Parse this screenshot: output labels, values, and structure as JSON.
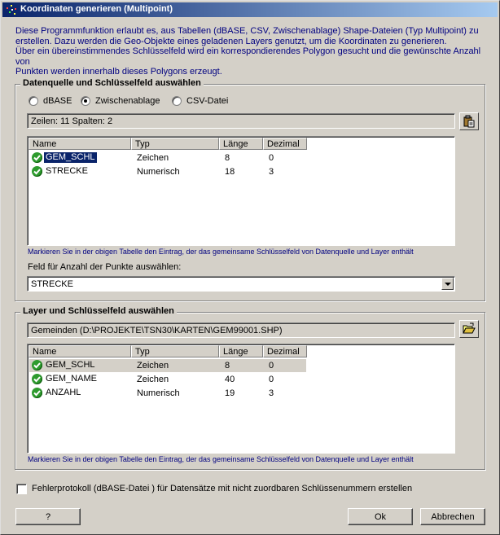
{
  "window": {
    "title": "Koordinaten generieren (Multipoint)"
  },
  "intro": {
    "line1": "Diese Programmfunktion erlaubt es, aus Tabellen (dBASE, CSV, Zwischenablage) Shape-Dateien (Typ Multipoint) zu",
    "line2": "erstellen. Dazu werden die Geo-Objekte eines geladenen Layers genutzt, um die Koordinaten zu generieren.",
    "line3": "Über ein übereinstimmendes Schlüsselfeld wird ein korrespondierendes Polygon gesucht und die gewünschte Anzahl von",
    "line4": "Punkten werden innerhalb dieses Polygons erzeugt."
  },
  "source": {
    "group_title": "Datenquelle und Schlüsselfeld auswählen",
    "radio_dbase": "dBASE",
    "radio_clipboard": "Zwischenablage",
    "radio_csv": "CSV-Datei",
    "selected_radio": "Zwischenablage",
    "info": "Zeilen: 11   Spalten: 2",
    "columns": {
      "name": "Name",
      "type": "Typ",
      "length": "Länge",
      "decimal": "Dezimal"
    },
    "rows": [
      {
        "name": "GEM_SCHL",
        "type": "Zeichen",
        "length": "8",
        "decimal": "0"
      },
      {
        "name": "STRECKE",
        "type": "Numerisch",
        "length": "18",
        "decimal": "3"
      }
    ],
    "hint": "Markieren Sie in der obigen Tabelle den Eintrag, der das gemeinsame Schlüsselfeld von Datenquelle und Layer enthält",
    "count_label": "Feld für Anzahl der Punkte auswählen:",
    "count_value": "STRECKE"
  },
  "layer": {
    "group_title": "Layer und Schlüsselfeld auswählen",
    "info": "Gemeinden (D:\\PROJEKTE\\TSN30\\KARTEN\\GEM99001.SHP)",
    "columns": {
      "name": "Name",
      "type": "Typ",
      "length": "Länge",
      "decimal": "Dezimal"
    },
    "rows": [
      {
        "name": "GEM_SCHL",
        "type": "Zeichen",
        "length": "8",
        "decimal": "0"
      },
      {
        "name": "GEM_NAME",
        "type": "Zeichen",
        "length": "40",
        "decimal": "0"
      },
      {
        "name": "ANZAHL",
        "type": "Numerisch",
        "length": "19",
        "decimal": "3"
      }
    ],
    "hint": "Markieren Sie in der obigen Tabelle den Eintrag, der das gemeinsame Schlüsselfeld von Datenquelle und Layer enthält"
  },
  "error_log": {
    "label": "Fehlerprotokoll (dBASE-Datei ) für Datensätze mit nicht zuordbaren Schlüssenummern erstellen",
    "checked": false
  },
  "buttons": {
    "help": "?",
    "ok": "Ok",
    "cancel": "Abbrechen"
  },
  "icons": {
    "app": "app-icon",
    "paste": "clipboard-paste-icon",
    "open_folder": "folder-open-icon",
    "check": "green-check-icon"
  },
  "colors": {
    "title_start": "#0a246a",
    "title_end": "#a6caf0",
    "hint_text": "#000080",
    "selection": "#0a246a",
    "check_green": "#2e9b2e"
  }
}
